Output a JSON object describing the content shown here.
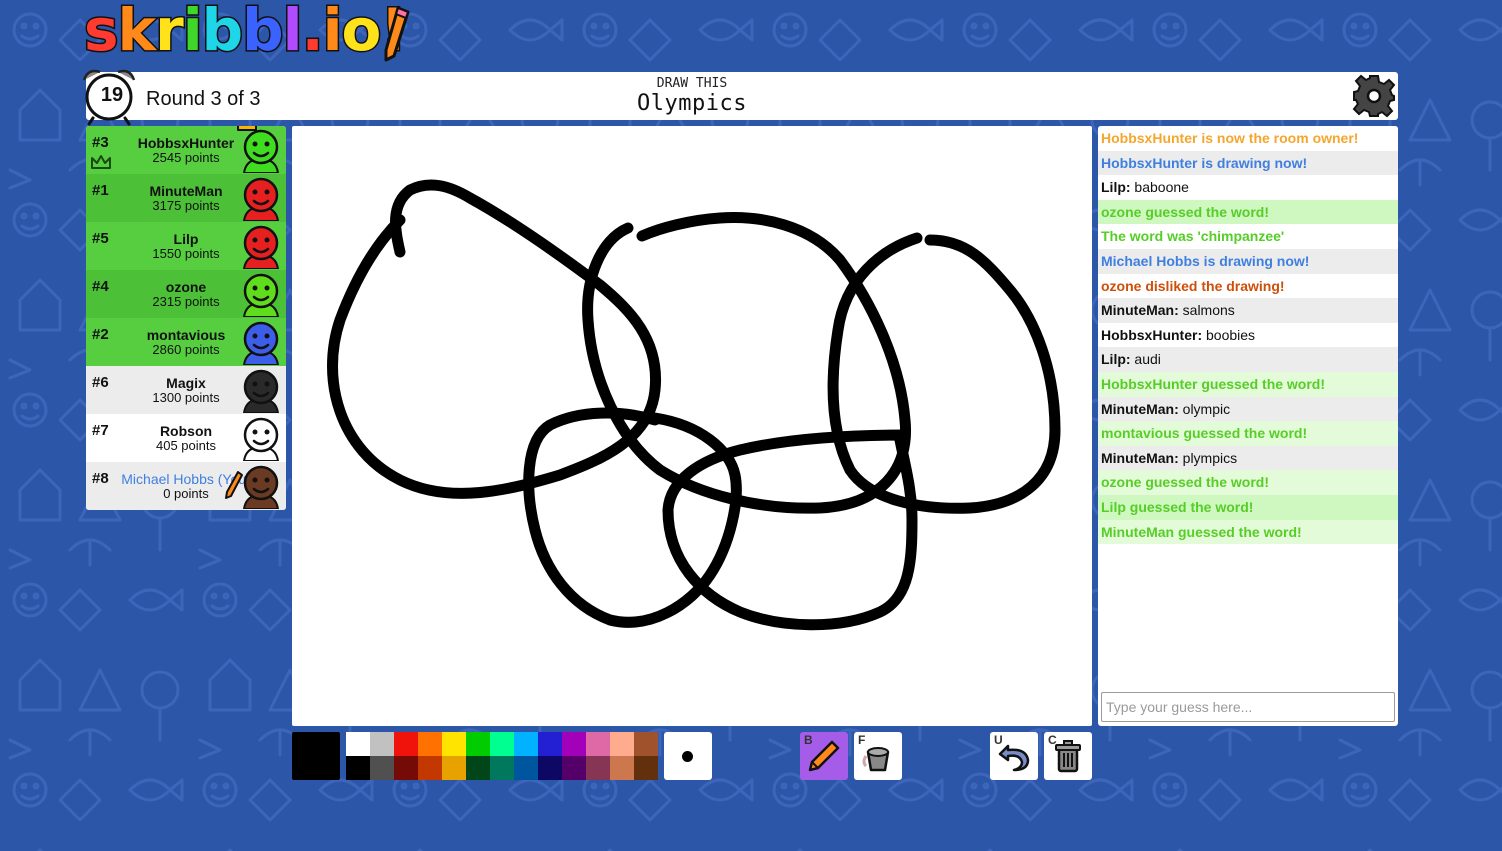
{
  "logo": {
    "letters": [
      "s",
      "k",
      "r",
      "i",
      "b",
      "b",
      "l",
      ".",
      "i",
      "o",
      "!"
    ],
    "colors": [
      "#ff3a2e",
      "#ff8a1a",
      "#ffe21a",
      "#3fd82a",
      "#1fd6e8",
      "#3a62ff",
      "#b14bff",
      "#ff3a2e",
      "#ff8a1a",
      "#ffe21a",
      "#ff8a1a"
    ]
  },
  "header": {
    "timer": "19",
    "round": "Round 3 of 3",
    "draw_label": "DRAW THIS",
    "word": "Olympics"
  },
  "icons": {
    "settings": "gear-icon",
    "clock": "alarm-clock-icon",
    "crown": "crown-icon",
    "pencil": "pencil-icon",
    "fill": "bucket-icon",
    "undo": "undo-icon",
    "clear": "trash-icon"
  },
  "players": [
    {
      "rank": "#3",
      "name": "HobbsxHunter",
      "points": "2545 points",
      "bg": "#56ce40",
      "face": "#3fdc20",
      "owner": true
    },
    {
      "rank": "#1",
      "name": "MinuteMan",
      "points": "3175 points",
      "bg": "#4cc137",
      "face": "#e62020"
    },
    {
      "rank": "#5",
      "name": "Lilp",
      "points": "1550 points",
      "bg": "#56ce40",
      "face": "#e62020"
    },
    {
      "rank": "#4",
      "name": "ozone",
      "points": "2315 points",
      "bg": "#4cc137",
      "face": "#5fdc1c"
    },
    {
      "rank": "#2",
      "name": "montavious",
      "points": "2860 points",
      "bg": "#56ce40",
      "face": "#3d5ee8"
    },
    {
      "rank": "#6",
      "name": "Magix",
      "points": "1300 points",
      "bg": "#ececec",
      "face": "#2a2a2a"
    },
    {
      "rank": "#7",
      "name": "Robson",
      "points": "405 points",
      "bg": "#ffffff",
      "face": "#ffffff"
    },
    {
      "rank": "#8",
      "name": "Michael Hobbs (You)",
      "points": "0 points",
      "bg": "#ececec",
      "face": "#6b3a22",
      "self": true,
      "drawing": true
    }
  ],
  "chat": {
    "messages": [
      {
        "author": "",
        "text": "HobbsxHunter is now the room owner!",
        "color": "#f5a62c",
        "bg": "#ffffff"
      },
      {
        "author": "",
        "text": "HobbsxHunter is drawing now!",
        "color": "#3f7fe0",
        "bg": "#ececec"
      },
      {
        "author": "Lilp:",
        "text": " baboone",
        "color": "#111111",
        "bg": "#ffffff"
      },
      {
        "author": "",
        "text": "ozone guessed the word!",
        "color": "#56ce27",
        "bg": "#cff7c0"
      },
      {
        "author": "",
        "text": "The word was 'chimpanzee'",
        "color": "#56ce27",
        "bg": "#ffffff"
      },
      {
        "author": "",
        "text": "Michael Hobbs is drawing now!",
        "color": "#3f7fe0",
        "bg": "#ececec"
      },
      {
        "author": "",
        "text": "ozone disliked the drawing!",
        "color": "#ce4f0a",
        "bg": "#ffffff"
      },
      {
        "author": "MinuteMan:",
        "text": " salmons",
        "color": "#111111",
        "bg": "#ececec"
      },
      {
        "author": "HobbsxHunter:",
        "text": " boobies",
        "color": "#111111",
        "bg": "#ffffff"
      },
      {
        "author": "Lilp:",
        "text": " audi",
        "color": "#111111",
        "bg": "#ececec"
      },
      {
        "author": "",
        "text": "HobbsxHunter guessed the word!",
        "color": "#56ce27",
        "bg": "#e4fbd9"
      },
      {
        "author": "MinuteMan:",
        "text": " olympic",
        "color": "#111111",
        "bg": "#ececec"
      },
      {
        "author": "",
        "text": "montavious guessed the word!",
        "color": "#56ce27",
        "bg": "#e4fbd9"
      },
      {
        "author": "MinuteMan:",
        "text": " plympics",
        "color": "#111111",
        "bg": "#ececec"
      },
      {
        "author": "",
        "text": "ozone guessed the word!",
        "color": "#56ce27",
        "bg": "#e4fbd9"
      },
      {
        "author": "",
        "text": "Lilp guessed the word!",
        "color": "#56ce27",
        "bg": "#cff7c0"
      },
      {
        "author": "",
        "text": "MinuteMan guessed the word!",
        "color": "#56ce27",
        "bg": "#e4fbd9"
      }
    ],
    "input_placeholder": "Type your guess here..."
  },
  "toolbar": {
    "current_color": "#000000",
    "palette_top": [
      "#ffffff",
      "#c1c1c1",
      "#ef130b",
      "#ff7100",
      "#ffe400",
      "#00cc00",
      "#00ff91",
      "#00b2ff",
      "#231fd3",
      "#a300ba",
      "#df69a7",
      "#ffac8e",
      "#a0522d"
    ],
    "palette_bottom": [
      "#000000",
      "#505050",
      "#740b07",
      "#c23800",
      "#e8a200",
      "#004619",
      "#00785d",
      "#00569e",
      "#0e0865",
      "#550069",
      "#873554",
      "#cc774d",
      "#63300d"
    ],
    "tools": {
      "brush_key": "B",
      "fill_key": "F",
      "undo_key": "U",
      "clear_key": "C"
    }
  },
  "strokes": [
    "M400,252 C395,230 390,205 410,190 C430,180 450,186 470,198 C510,220 560,255 600,285 C630,310 660,340 655,390 C650,440 600,460 560,475 C510,490 450,505 400,480 C340,450 320,380 340,320 C355,280 375,245 400,220",
    "M628,228 C600,240 585,280 588,320 C592,380 620,440 660,470 C700,495 760,510 820,508 C880,505 910,470 905,420 C900,360 870,300 840,260 C810,225 760,215 720,218 C690,220 660,228 642,236",
    "M917,238 C880,250 845,280 838,330 C830,380 830,430 850,470 C870,500 920,510 970,508 C1020,505 1055,480 1055,430 C1055,370 1035,320 1010,290 C985,260 965,240 930,240",
    "M655,420 C620,410 580,410 550,425 C525,440 525,490 535,530 C545,570 570,605 610,620 C650,630 690,605 710,575 C730,545 740,500 735,475 C730,450 700,425 655,418",
    "M905,435 C850,435 790,438 740,450 C700,460 670,480 668,510 C668,560 700,595 740,612 C780,628 840,630 880,612 C910,598 912,560 912,520 C912,490 905,465 900,440"
  ]
}
